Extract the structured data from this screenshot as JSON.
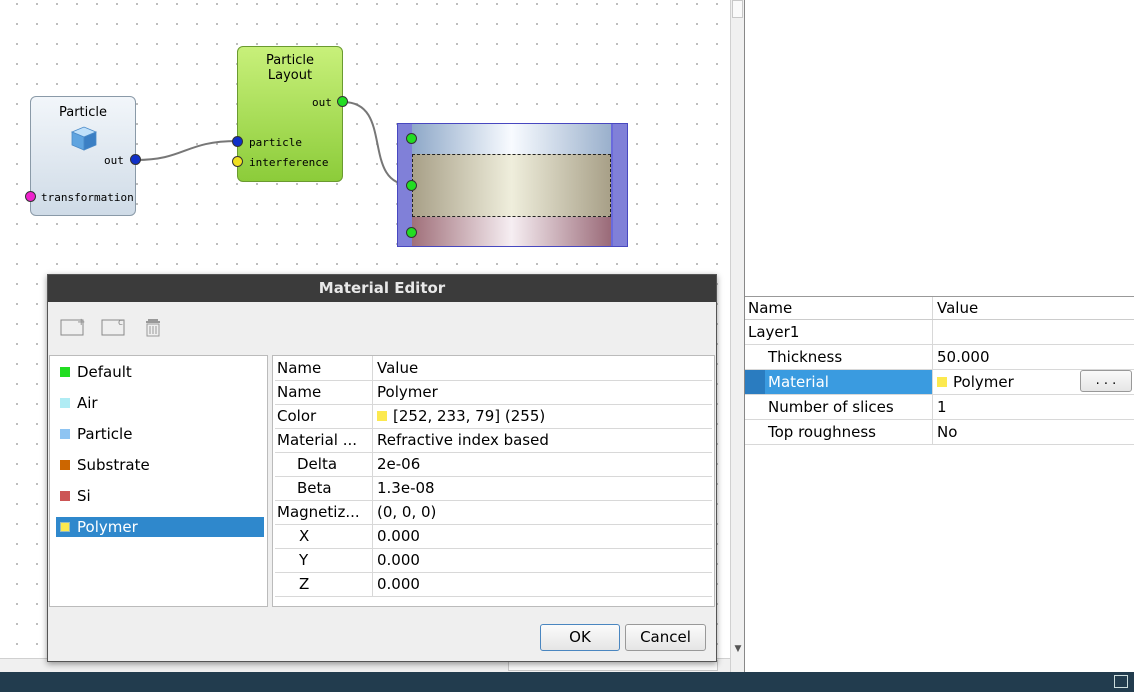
{
  "nodes": {
    "particle": {
      "title": "Particle",
      "out_label": "out",
      "transformation_label": "transformation"
    },
    "particle_layout": {
      "title_line1": "Particle",
      "title_line2": "Layout",
      "out_label": "out",
      "particle_label": "particle",
      "interference_label": "interference"
    }
  },
  "properties_panel": {
    "header": {
      "name": "Name",
      "value": "Value"
    },
    "rows": [
      {
        "name": "Layer1",
        "value": ""
      },
      {
        "name": "Thickness",
        "value": "50.000"
      },
      {
        "name": "Material",
        "value": "Polymer",
        "swatch": "#fce94f",
        "button": ". . ."
      },
      {
        "name": "Number of slices",
        "value": "1"
      },
      {
        "name": "Top roughness",
        "value": "No"
      }
    ]
  },
  "dialog": {
    "title": "Material Editor",
    "toolbar": {
      "add_icon": "add-material-icon",
      "clone_icon": "clone-material-icon",
      "remove_icon": "trash-icon"
    },
    "materials": [
      {
        "name": "Default",
        "color": "#22dd22"
      },
      {
        "name": "Air",
        "color": "#b0ecf4"
      },
      {
        "name": "Particle",
        "color": "#8ec4f2"
      },
      {
        "name": "Substrate",
        "color": "#cc6600"
      },
      {
        "name": "Si",
        "color": "#cc5555"
      },
      {
        "name": "Polymer",
        "color": "#fce94f"
      }
    ],
    "selected_material": "Polymer",
    "properties": {
      "header": {
        "name": "Name",
        "value": "Value"
      },
      "rows": [
        {
          "name": "Name",
          "value": "Polymer"
        },
        {
          "name": "Color",
          "value": "[252, 233, 79] (255)",
          "swatch": "#fce94f"
        },
        {
          "name": "Material ...",
          "value": "Refractive index based"
        },
        {
          "name": "Delta",
          "value": "2e-06"
        },
        {
          "name": "Beta",
          "value": "1.3e-08"
        },
        {
          "name": "Magnetiz...",
          "value": "(0, 0, 0)"
        },
        {
          "name": "X",
          "value": "0.000"
        },
        {
          "name": "Y",
          "value": "0.000"
        },
        {
          "name": "Z",
          "value": "0.000"
        }
      ]
    },
    "ok_label": "OK",
    "cancel_label": "Cancel"
  }
}
